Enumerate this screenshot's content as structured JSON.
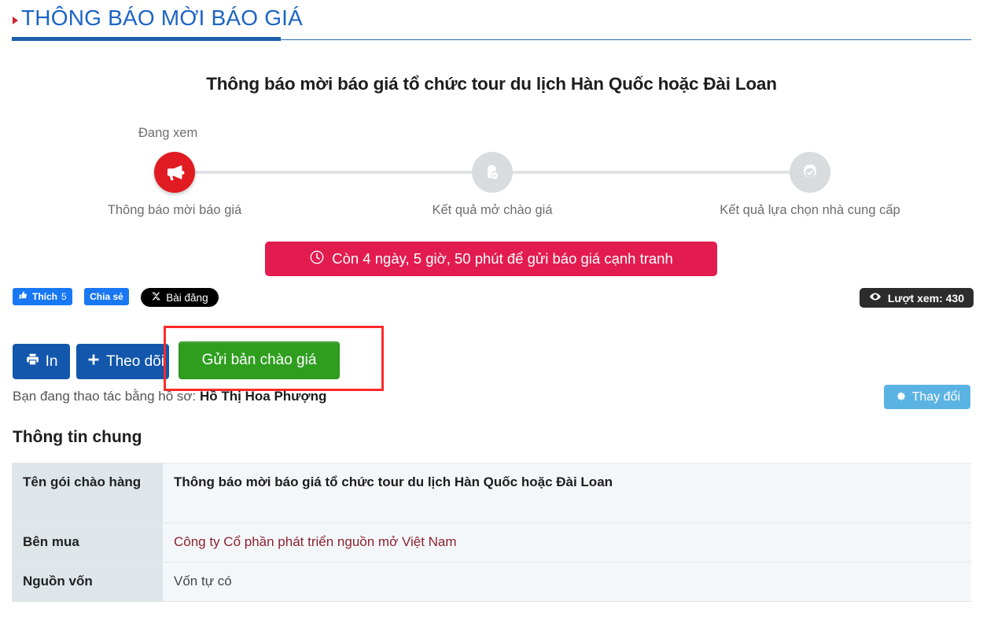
{
  "header": {
    "title": "THÔNG BÁO MỜI BÁO GIÁ",
    "accent_color": "#1b64c4",
    "arrow_color": "#c9252b"
  },
  "notice": {
    "title": "Thông báo mời báo giá tổ chức tour du lịch Hàn Quốc hoặc Đài Loan"
  },
  "stepper": {
    "viewing_label": "Đang xem",
    "active_color": "#e01b22",
    "inactive_color": "#d9dcdf",
    "steps": [
      {
        "label": "Thông báo mời báo giá",
        "icon": "megaphone-icon",
        "state": "active"
      },
      {
        "label": "Kết quả mở chào giá",
        "icon": "clipboard-check-icon",
        "state": "inactive"
      },
      {
        "label": "Kết quả lựa chọn nhà cung cấp",
        "icon": "award-badge-icon",
        "state": "inactive"
      }
    ]
  },
  "countdown": {
    "text": "Còn 4 ngày, 5 giờ, 50 phút để gửi báo giá cạnh tranh",
    "icon": "clock-icon",
    "background": "#e31c50",
    "days": 4,
    "hours": 5,
    "minutes": 50
  },
  "social": {
    "like_label": "Thích",
    "like_count": "5",
    "share_label": "Chia sẻ",
    "x_post_label": "Bài đăng",
    "facebook_color": "#1877f2",
    "x_color": "#000000"
  },
  "views": {
    "label": "Lượt xem: 430",
    "count": 430,
    "icon": "eye-icon"
  },
  "actions": {
    "print_label": "In",
    "print_icon": "printer-icon",
    "follow_label": "Theo dõi",
    "follow_icon": "plus-icon",
    "quote_label": "Gửi bản chào giá",
    "quote_color": "#2f9e1f",
    "highlight_color": "#fc2b2b"
  },
  "profile": {
    "prefix": "Bạn đang thao tác bằng hồ sơ:",
    "name": "Hồ Thị Hoa Phượng",
    "change_label": "Thay đổi",
    "change_icon": "gear-icon"
  },
  "general_info": {
    "heading": "Thông tin chung",
    "rows": [
      {
        "key": "Tên gói chào hàng",
        "value": "Thông báo mời báo giá tổ chức tour du lịch Hàn Quốc hoặc Đài Loan",
        "style": "strong"
      },
      {
        "key": "Bên mua",
        "value": "Công ty Cổ phần phát triển nguồn mở Việt Nam",
        "style": "link"
      },
      {
        "key": "Nguồn vốn",
        "value": "Vốn tự có",
        "style": "plain"
      }
    ]
  }
}
